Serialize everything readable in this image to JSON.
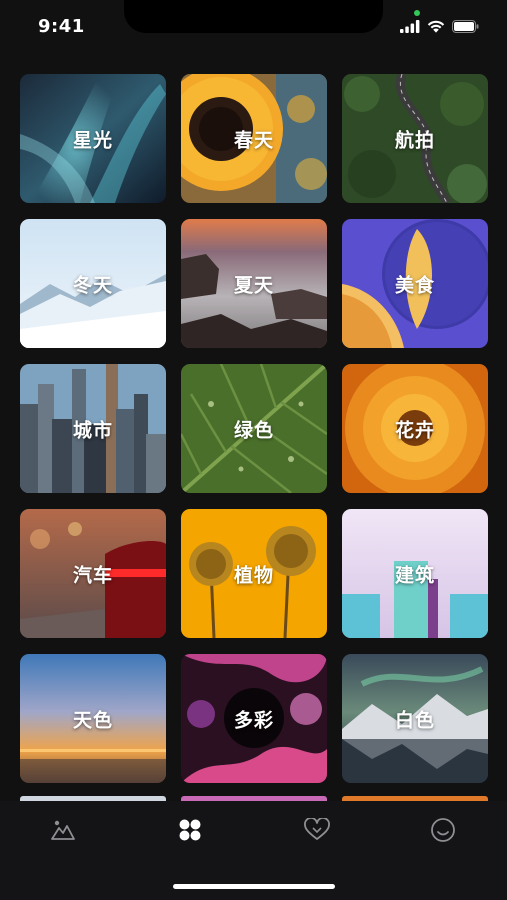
{
  "status_bar": {
    "time": "9:41",
    "icons": [
      "signal-bars-icon",
      "wifi-icon",
      "battery-icon"
    ],
    "indicator_color": "#34c759"
  },
  "categories": [
    {
      "label": "星光",
      "art": "aurora"
    },
    {
      "label": "春天",
      "art": "sunflower"
    },
    {
      "label": "航拍",
      "art": "aerial-road"
    },
    {
      "label": "冬天",
      "art": "snow-mountains"
    },
    {
      "label": "夏天",
      "art": "rocky-shore"
    },
    {
      "label": "美食",
      "art": "melon"
    },
    {
      "label": "城市",
      "art": "city-skyline"
    },
    {
      "label": "绿色",
      "art": "green-leaf"
    },
    {
      "label": "花卉",
      "art": "orange-flower"
    },
    {
      "label": "汽车",
      "art": "red-car"
    },
    {
      "label": "植物",
      "art": "yellow-dandelions"
    },
    {
      "label": "建筑",
      "art": "pastel-buildings"
    },
    {
      "label": "天色",
      "art": "sunset-sky"
    },
    {
      "label": "多彩",
      "art": "fluid-art"
    },
    {
      "label": "白色",
      "art": "snowy-lake"
    }
  ],
  "tab_bar": {
    "tabs": [
      {
        "icon": "gallery-mountain-icon",
        "active": false
      },
      {
        "icon": "grid-categories-icon",
        "active": true
      },
      {
        "icon": "heart-favorites-icon",
        "active": false
      },
      {
        "icon": "smiley-profile-icon",
        "active": false
      }
    ],
    "active_color": "#ffffff",
    "inactive_color": "#8e8e93"
  }
}
